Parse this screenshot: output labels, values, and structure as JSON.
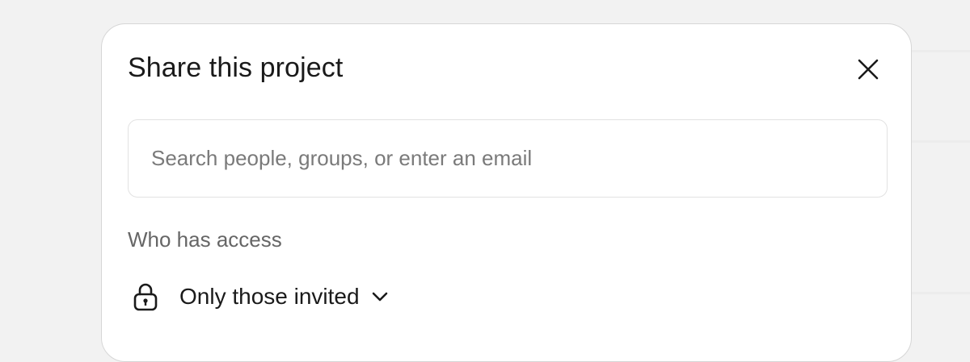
{
  "dialog": {
    "title": "Share this project",
    "close_icon": "close-icon"
  },
  "search": {
    "placeholder": "Search people, groups, or enter an email",
    "value": ""
  },
  "access": {
    "label": "Who has access",
    "selected": "Only those invited",
    "lock_icon": "lock-icon",
    "chevron_icon": "chevron-down-icon"
  }
}
